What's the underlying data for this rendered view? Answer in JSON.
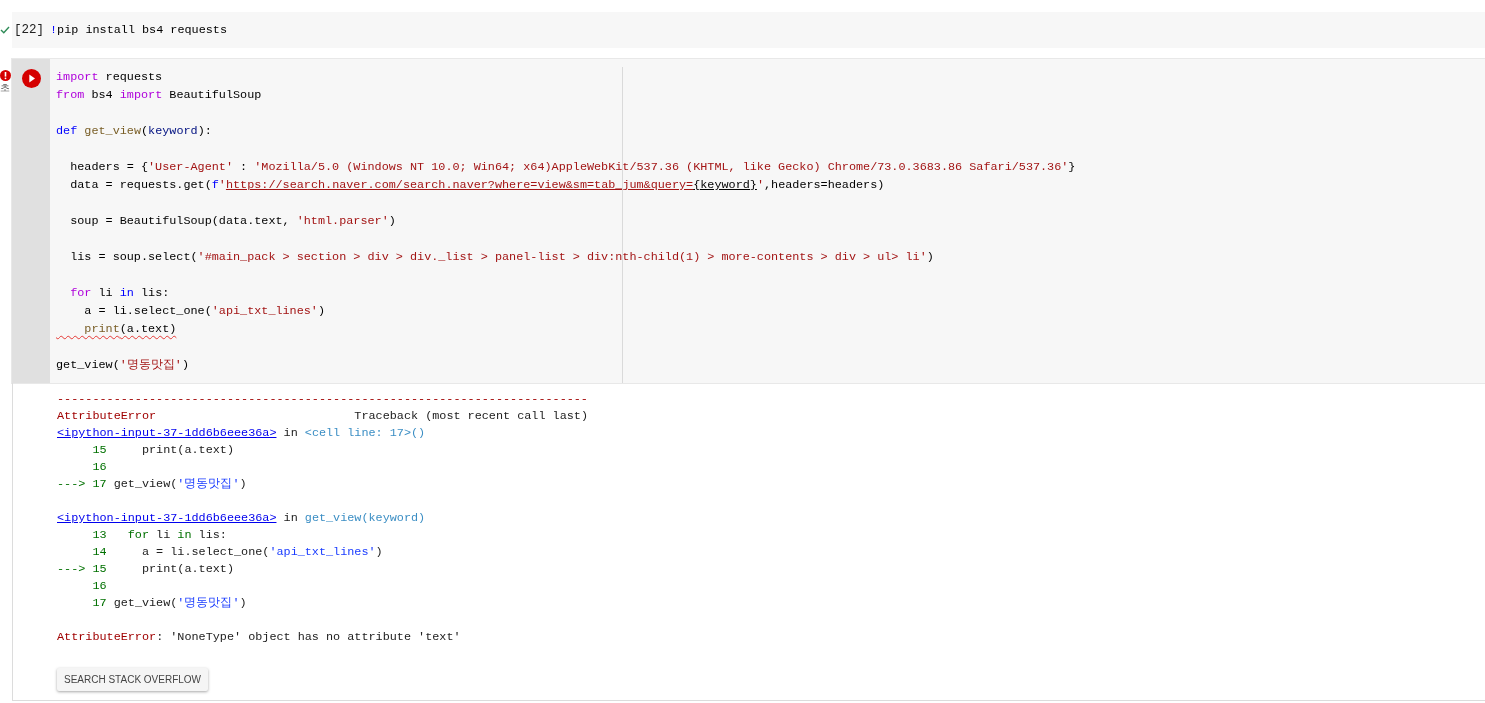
{
  "cells": [
    {
      "kind": "success",
      "focused": false,
      "count": "[22]",
      "blocks": [
        [
          {
            "squiggle": false,
            "tokens": [
              {
                "kind": "bang",
                "text": "!"
              },
              {
                "kind": "plain",
                "text": "pip install bs4 requests"
              }
            ]
          }
        ]
      ]
    },
    {
      "kind": "error",
      "focused": true,
      "time": "초",
      "blocks": [
        [
          {
            "squiggle": false,
            "tokens": [
              {
                "kind": "kw",
                "text": "import"
              },
              {
                "kind": "plain",
                "text": " requests"
              }
            ]
          },
          {
            "squiggle": false,
            "tokens": [
              {
                "kind": "kw",
                "text": "from"
              },
              {
                "kind": "plain",
                "text": " bs4 "
              },
              {
                "kind": "kw",
                "text": "import"
              },
              {
                "kind": "plain",
                "text": " BeautifulSoup"
              }
            ]
          }
        ],
        [
          {
            "squiggle": false,
            "tokens": [
              {
                "kind": "def",
                "text": "def"
              },
              {
                "kind": "fn",
                "text": " get_view"
              },
              {
                "kind": "plain",
                "text": "("
              },
              {
                "kind": "param",
                "text": "keyword"
              },
              {
                "kind": "plain",
                "text": "):"
              }
            ]
          }
        ],
        [
          {
            "squiggle": false,
            "tokens": [
              {
                "kind": "plain",
                "text": "  headers = {"
              },
              {
                "kind": "str",
                "text": "'User-Agent'"
              },
              {
                "kind": "plain",
                "text": " : "
              },
              {
                "kind": "str",
                "text": "'Mozilla/5.0 (Windows NT 10.0; Win64; x64)AppleWebKit/537.36 (KHTML, like Gecko) Chrome/73.0.3683.86 Safari/537.36'"
              },
              {
                "kind": "plain",
                "text": "}"
              }
            ]
          },
          {
            "squiggle": false,
            "tokens": [
              {
                "kind": "plain",
                "text": "  data = requests.get("
              },
              {
                "kind": "def",
                "text": "f"
              },
              {
                "kind": "str",
                "text": "'"
              },
              {
                "kind": "url",
                "text": "https://search.naver.com/search.naver?where=view&sm=tab_jum&query="
              },
              {
                "kind": "interp",
                "text": "{keyword}"
              },
              {
                "kind": "str",
                "text": "'"
              },
              {
                "kind": "plain",
                "text": ",headers=headers)"
              }
            ]
          }
        ],
        [
          {
            "squiggle": false,
            "tokens": [
              {
                "kind": "plain",
                "text": "  soup = BeautifulSoup(data.text, "
              },
              {
                "kind": "str",
                "text": "'html.parser'"
              },
              {
                "kind": "plain",
                "text": ")"
              }
            ]
          }
        ],
        [
          {
            "squiggle": false,
            "tokens": [
              {
                "kind": "plain",
                "text": "  lis = soup.select("
              },
              {
                "kind": "str",
                "text": "'#main_pack > section > div > div._list > panel-list > div:nth-child(1) > more-contents > div > ul> li'"
              },
              {
                "kind": "plain",
                "text": ")"
              }
            ]
          }
        ],
        [
          {
            "squiggle": false,
            "tokens": [
              {
                "kind": "kw",
                "text": "  for"
              },
              {
                "kind": "plain",
                "text": " li "
              },
              {
                "kind": "def",
                "text": "in"
              },
              {
                "kind": "plain",
                "text": " lis:"
              }
            ]
          },
          {
            "squiggle": false,
            "tokens": [
              {
                "kind": "plain",
                "text": "    a = li.select_one("
              },
              {
                "kind": "str",
                "text": "'api_txt_lines'"
              },
              {
                "kind": "plain",
                "text": ")"
              }
            ]
          },
          {
            "squiggle": true,
            "tokens": [
              {
                "kind": "fn",
                "text": "    print"
              },
              {
                "kind": "plain",
                "text": "(a.text)"
              }
            ]
          }
        ],
        [
          {
            "squiggle": false,
            "tokens": [
              {
                "kind": "plain",
                "text": "get_view("
              },
              {
                "kind": "str",
                "text": "'명동맛집'"
              },
              {
                "kind": "plain",
                "text": ")"
              }
            ]
          }
        ]
      ],
      "output": {
        "blocks": [
          [
            [
              {
                "kind": "err",
                "text": "---------------------------------------------------------------------------"
              }
            ],
            [
              {
                "kind": "err",
                "text": "AttributeError"
              },
              {
                "kind": "plain",
                "text": "                            Traceback (most recent call last)"
              }
            ],
            [
              {
                "kind": "link",
                "text": "<ipython-input-37-1dd6b6eee36a>"
              },
              {
                "kind": "plain",
                "text": " in "
              },
              {
                "kind": "func",
                "text": "<cell line: 17>()"
              }
            ],
            [
              {
                "kind": "num",
                "text": "     15"
              },
              {
                "kind": "plain",
                "text": "     print(a.text)"
              }
            ],
            [
              {
                "kind": "num",
                "text": "     16"
              }
            ],
            [
              {
                "kind": "num",
                "text": "---> 17"
              },
              {
                "kind": "plain",
                "text": " get_view("
              },
              {
                "kind": "str",
                "text": "'명동맛집'"
              },
              {
                "kind": "plain",
                "text": ")"
              }
            ]
          ],
          [
            [
              {
                "kind": "link",
                "text": "<ipython-input-37-1dd6b6eee36a>"
              },
              {
                "kind": "plain",
                "text": " in "
              },
              {
                "kind": "func",
                "text": "get_view(keyword)"
              }
            ],
            [
              {
                "kind": "num",
                "text": "     13   for"
              },
              {
                "kind": "plain",
                "text": " li "
              },
              {
                "kind": "num",
                "text": "in"
              },
              {
                "kind": "plain",
                "text": " lis:"
              }
            ],
            [
              {
                "kind": "num",
                "text": "     14"
              },
              {
                "kind": "plain",
                "text": "     a = li.select_one("
              },
              {
                "kind": "str",
                "text": "'api_txt_lines'"
              },
              {
                "kind": "plain",
                "text": ")"
              }
            ],
            [
              {
                "kind": "num",
                "text": "---> 15"
              },
              {
                "kind": "plain",
                "text": "     print(a.text)"
              }
            ],
            [
              {
                "kind": "num",
                "text": "     16"
              }
            ],
            [
              {
                "kind": "num",
                "text": "     17"
              },
              {
                "kind": "plain",
                "text": " get_view("
              },
              {
                "kind": "str",
                "text": "'명동맛집'"
              },
              {
                "kind": "plain",
                "text": ")"
              }
            ]
          ],
          [
            [
              {
                "kind": "err",
                "text": "AttributeError"
              },
              {
                "kind": "plain",
                "text": ": 'NoneType' object has no attribute 'text'"
              }
            ]
          ]
        ],
        "button": "SEARCH STACK OVERFLOW"
      }
    }
  ]
}
